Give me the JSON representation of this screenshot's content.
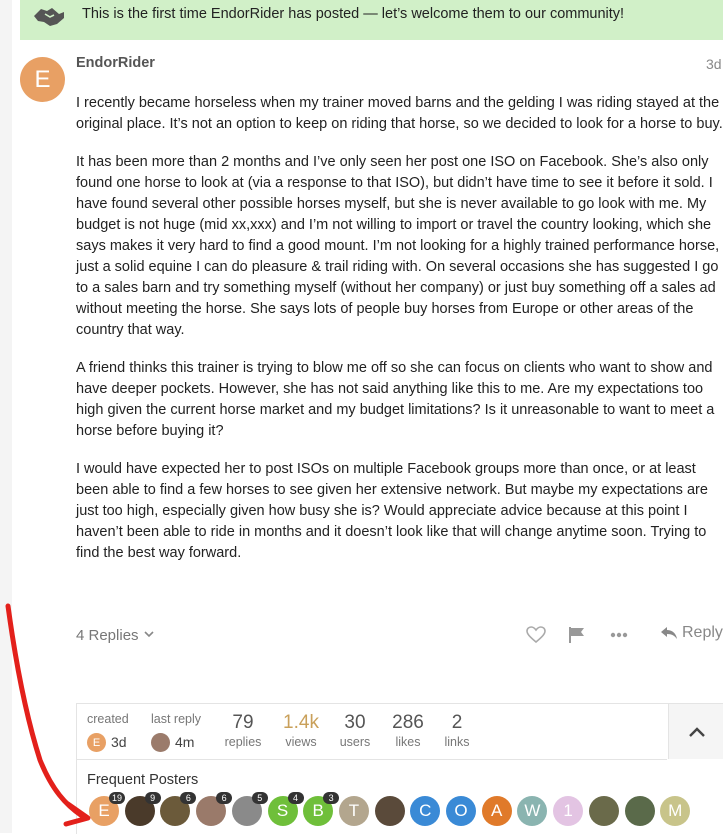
{
  "banner": {
    "text": "This is the first time EndorRider has posted — let’s welcome them to our community!"
  },
  "post": {
    "avatar_letter": "E",
    "username": "EndorRider",
    "date": "3d",
    "paragraphs": [
      "I recently became horseless when my trainer moved barns and the gelding I was riding stayed at the original place. It’s not an option to keep on riding that horse, so we decided to look for a horse to buy.",
      "It has been more than 2 months and I’ve only seen her post one ISO on Facebook. She’s also only found one horse to look at (via a response to that ISO), but didn’t have time to see it before it sold. I have found several other possible horses myself, but she is never available to go look with me. My budget is not huge (mid xx,xxx) and I’m not willing to import or travel the country looking, which she says makes it very hard to find a good mount. I’m not looking for a highly trained performance horse, just a solid equine I can do pleasure & trail riding with. On several occasions she has suggested I go to a sales barn and try something myself (without her company) or just buy something off a sales ad without meeting the horse. She says lots of people buy horses from Europe or other areas of the country that way.",
      "A friend thinks this trainer is trying to blow me off so she can focus on clients who want to show and have deeper pockets. However, she has not said anything like this to me. Are my expectations too high given the current horse market and my budget limitations? Is it unreasonable to want to meet a horse before buying it?",
      "I would have expected her to post ISOs on multiple Facebook groups more than once, or at least been able to find a few horses to see given her extensive network. But maybe my expectations are just too high, especially given how busy she is? Would appreciate advice because at this point I haven’t been able to ride in months and it doesn’t look like that will change anytime soon. Trying to find the best way forward."
    ],
    "replies_label": "4 Replies",
    "reply_label": "Reply"
  },
  "topic_map": {
    "created_label": "created",
    "created_value": "3d",
    "created_avatar": "E",
    "last_reply_label": "last reply",
    "last_reply_value": "4m",
    "stats": [
      {
        "num": "79",
        "label": "replies"
      },
      {
        "num": "1.4k",
        "label": "views"
      },
      {
        "num": "30",
        "label": "users"
      },
      {
        "num": "286",
        "label": "likes"
      },
      {
        "num": "2",
        "label": "links"
      }
    ],
    "frequent_label": "Frequent Posters",
    "posters": [
      {
        "letter": "E",
        "color": "#e8a064",
        "badge": "19"
      },
      {
        "letter": "",
        "color": "#4a3a2a",
        "badge": "9"
      },
      {
        "letter": "",
        "color": "#6b5a3a",
        "badge": "6"
      },
      {
        "letter": "",
        "color": "#9a7a6a",
        "badge": "6"
      },
      {
        "letter": "",
        "color": "#8a8a8a",
        "badge": "5"
      },
      {
        "letter": "S",
        "color": "#6fbf3a",
        "badge": "4"
      },
      {
        "letter": "B",
        "color": "#6fbf3a",
        "badge": "3"
      },
      {
        "letter": "T",
        "color": "#b3a68e",
        "badge": ""
      },
      {
        "letter": "",
        "color": "#5a4a3a",
        "badge": ""
      },
      {
        "letter": "C",
        "color": "#3a8ad6",
        "badge": ""
      },
      {
        "letter": "O",
        "color": "#3a8ad6",
        "badge": ""
      },
      {
        "letter": "A",
        "color": "#e07a2a",
        "badge": ""
      },
      {
        "letter": "W",
        "color": "#8ab4b0",
        "badge": ""
      },
      {
        "letter": "1",
        "color": "#e3c4e3",
        "badge": ""
      },
      {
        "letter": "",
        "color": "#6a6a4a",
        "badge": ""
      },
      {
        "letter": "",
        "color": "#5a6a4a",
        "badge": ""
      },
      {
        "letter": "M",
        "color": "#c8c48a",
        "badge": ""
      }
    ]
  },
  "colors": {
    "banner_bg": "#d1f0c8",
    "accent_arrow": "#e3201b"
  }
}
